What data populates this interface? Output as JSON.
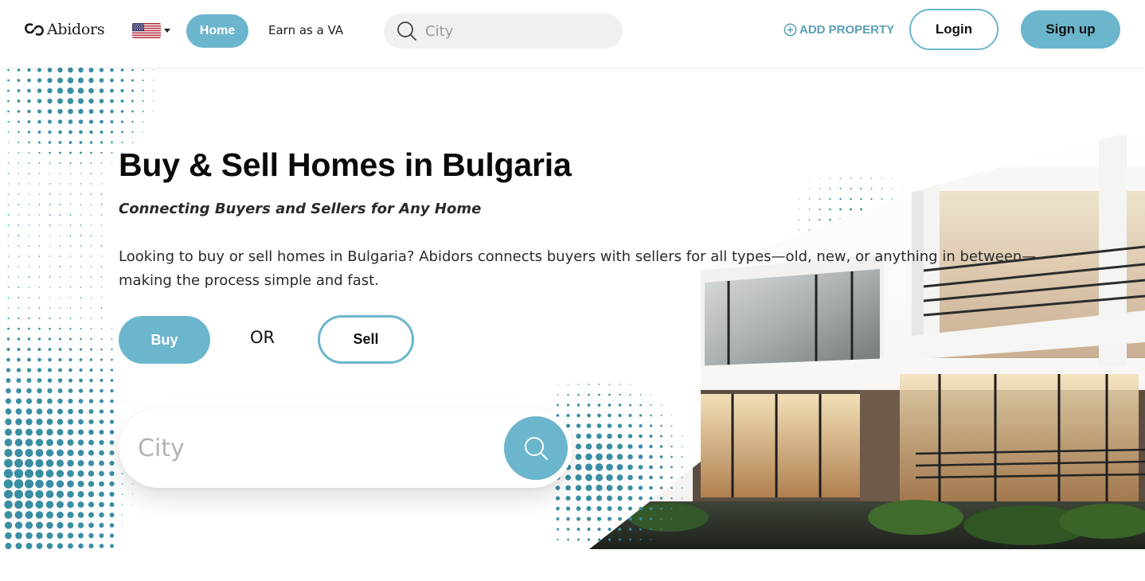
{
  "header": {
    "logo_text": "Abidors",
    "flag_icon": "us-flag-icon",
    "nav": {
      "home_label": "Home",
      "earn_label": "Earn as a VA"
    },
    "search": {
      "placeholder": "City"
    },
    "add_property_label": "ADD PROPERTY",
    "login_label": "Login",
    "signup_label": "Sign up"
  },
  "hero": {
    "title": "Buy & Sell Homes in Bulgaria",
    "subtitle": "Connecting Buyers and Sellers for Any Home",
    "description": "Looking to buy or sell homes in Bulgaria? Abidors connects buyers with sellers for all types—old, new, or anything in between—making the process simple and fast.",
    "buy_label": "Buy",
    "or_label": "OR",
    "sell_label": "Sell",
    "search": {
      "placeholder": "City"
    }
  },
  "colors": {
    "accent": "#6cb6cd",
    "accent_text": "#5a9fb4",
    "dots": "#3a8ea4"
  }
}
